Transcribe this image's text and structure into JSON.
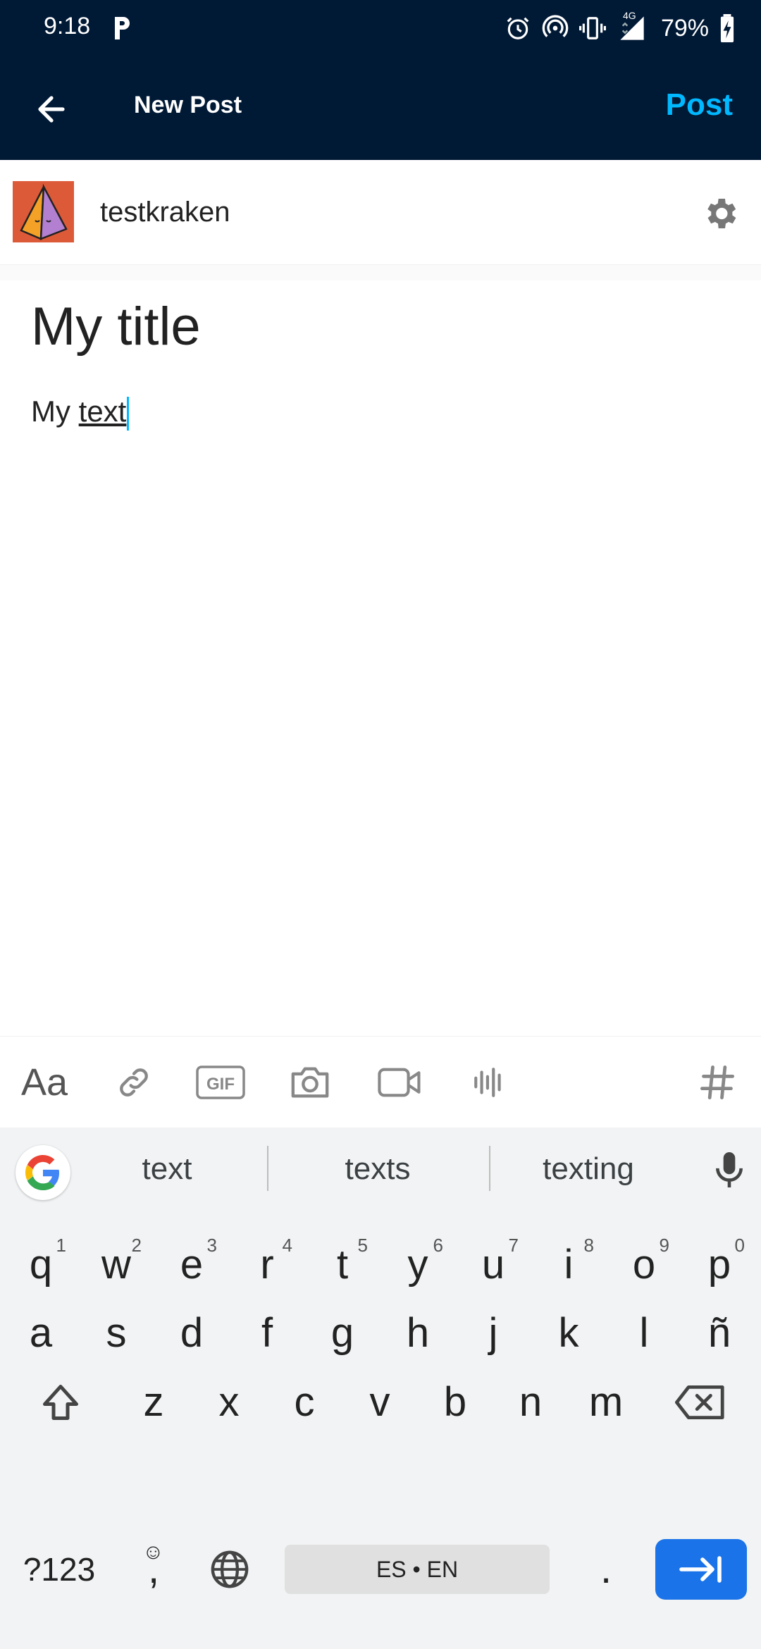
{
  "status_bar": {
    "time": "9:18",
    "battery": "79%",
    "network": "4G"
  },
  "header": {
    "title": "New Post",
    "post_label": "Post"
  },
  "blog": {
    "name": "testkraken"
  },
  "editor": {
    "title": "My title",
    "body_plain": "My ",
    "body_underlined": "text"
  },
  "toolbar": {
    "text_style_label": "Aa"
  },
  "keyboard": {
    "suggestions": [
      "text",
      "texts",
      "texting"
    ],
    "row1": [
      {
        "k": "q",
        "n": "1"
      },
      {
        "k": "w",
        "n": "2"
      },
      {
        "k": "e",
        "n": "3"
      },
      {
        "k": "r",
        "n": "4"
      },
      {
        "k": "t",
        "n": "5"
      },
      {
        "k": "y",
        "n": "6"
      },
      {
        "k": "u",
        "n": "7"
      },
      {
        "k": "i",
        "n": "8"
      },
      {
        "k": "o",
        "n": "9"
      },
      {
        "k": "p",
        "n": "0"
      }
    ],
    "row2": [
      "a",
      "s",
      "d",
      "f",
      "g",
      "h",
      "j",
      "k",
      "l",
      "ñ"
    ],
    "row3": [
      "z",
      "x",
      "c",
      "v",
      "b",
      "n",
      "m"
    ],
    "symbols_label": "?123",
    "comma": ",",
    "space_label": "ES • EN",
    "period": "."
  },
  "colors": {
    "header_bg": "#001935",
    "accent": "#00b8ff",
    "enter_key": "#1a73e8",
    "avatar_bg": "#dd5a39"
  }
}
